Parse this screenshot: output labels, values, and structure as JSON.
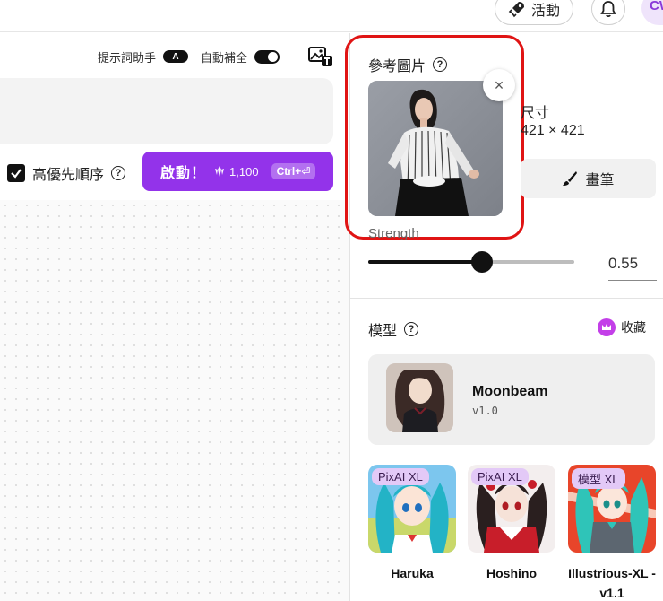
{
  "header": {
    "activity_label": "活動",
    "avatar_initials": "CW"
  },
  "editor": {
    "prompt_assistant_label": "提示詞助手",
    "prompt_assistant_badge": "A",
    "autocomplete_label": "自動補全",
    "autocomplete_enabled": true,
    "high_priority_label": "高優先順序",
    "high_priority_checked": true,
    "help_glyph": "?",
    "start_label": "啟動！",
    "credits": "1,100",
    "shortcut": "Ctrl+⏎"
  },
  "reference": {
    "title": "參考圖片",
    "size_label": "尺寸",
    "size_value": "421 × 421",
    "brush_label": "畫筆",
    "strength_label": "Strength",
    "strength_value": 0.55,
    "strength_display": "0.55",
    "close_glyph": "×"
  },
  "model": {
    "title": "模型",
    "favorites_label": "收藏",
    "selected": {
      "name": "Moonbeam",
      "version": "v1.0"
    },
    "options": [
      {
        "badge": "PixAI XL",
        "name": "Haruka"
      },
      {
        "badge": "PixAI XL",
        "name": "Hoshino"
      },
      {
        "badge": "模型 XL",
        "name": "Illustrious-XL -v1.1"
      }
    ]
  },
  "colors": {
    "accent": "#9333ea",
    "highlight": "#e01414"
  }
}
